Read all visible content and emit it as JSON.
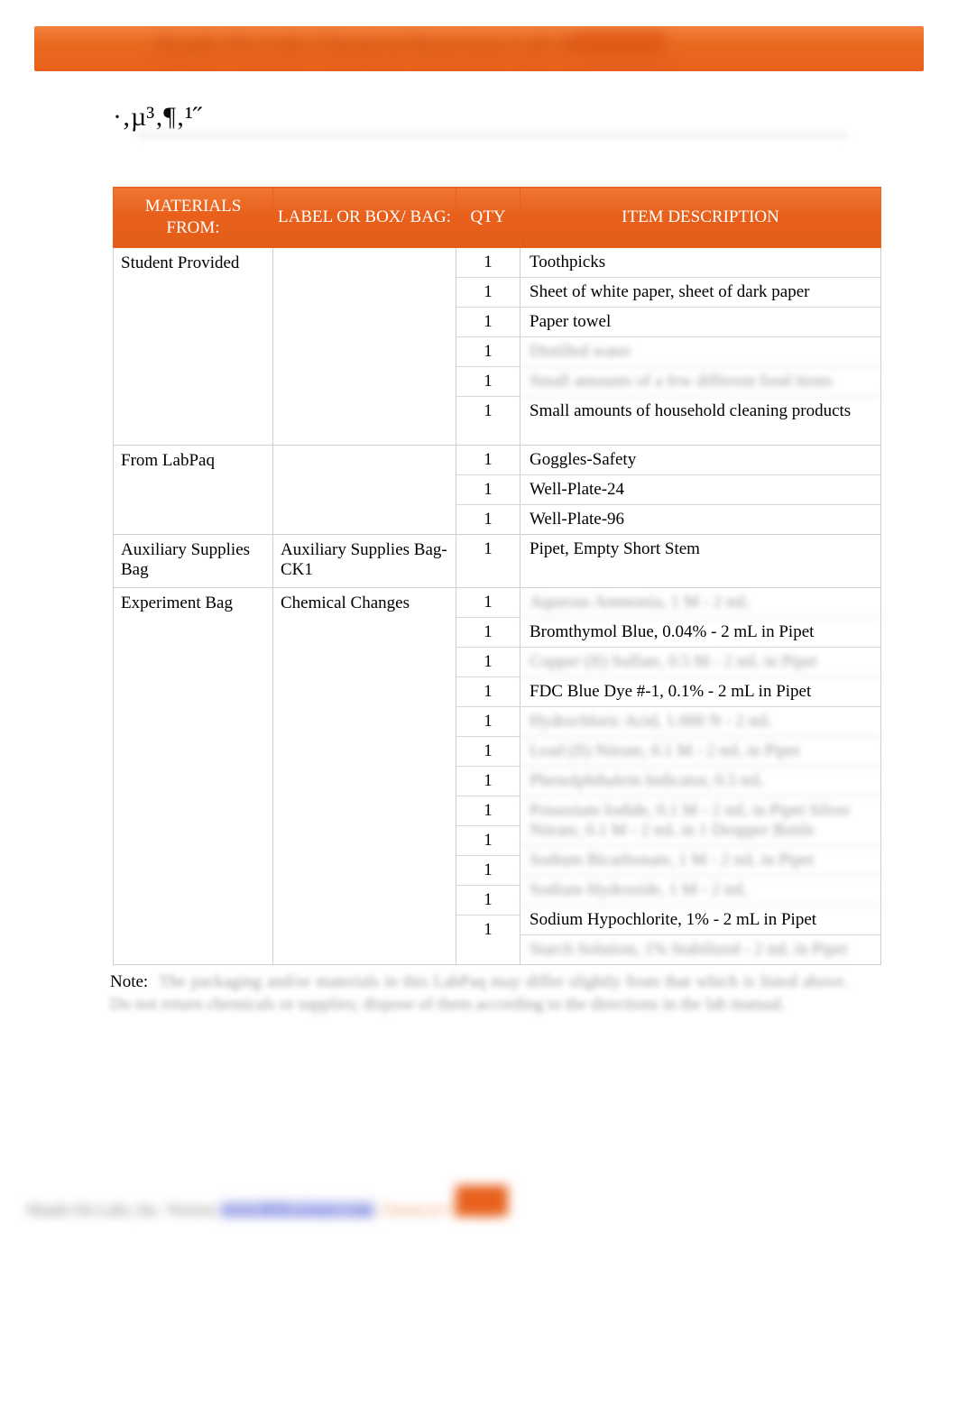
{
  "banner": {
    "title_redacted": "Hands-On Labs   Chemical Reactions Lab Manual",
    "accent_color": "#e8601c"
  },
  "heading": {
    "text": "·‚µ³‚¶‚¹˝"
  },
  "table": {
    "columns": [
      {
        "key": "from",
        "label": "MATERIALS FROM:"
      },
      {
        "key": "label",
        "label": "LABEL OR BOX/ BAG:"
      },
      {
        "key": "qty",
        "label": "QTY"
      },
      {
        "key": "desc",
        "label": "ITEM DESCRIPTION"
      }
    ],
    "header_bg": "#e8601c",
    "header_text_color": "#ffffff",
    "groups": [
      {
        "from": "Student Provided",
        "label": "",
        "items": [
          {
            "qty": "1",
            "desc": "Toothpicks",
            "redacted": false,
            "justify": false
          },
          {
            "qty": "1",
            "desc": "Sheet of white paper, sheet of dark paper",
            "redacted": false,
            "justify": false
          },
          {
            "qty": "1",
            "desc": "Paper towel",
            "redacted": false,
            "justify": false
          },
          {
            "qty": "1",
            "desc": "Distilled water",
            "redacted": true,
            "justify": false
          },
          {
            "qty": "1",
            "desc": "Small amounts of a few different food items",
            "redacted": true,
            "justify": false
          },
          {
            "qty": "1",
            "desc": "Small amounts of household cleaning products",
            "redacted": false,
            "justify": true
          }
        ]
      },
      {
        "from": "From LabPaq",
        "label": "",
        "items": [
          {
            "qty": "1",
            "desc": "Goggles-Safety",
            "redacted": false,
            "justify": false
          },
          {
            "qty": "1",
            "desc": "Well-Plate-24",
            "redacted": false,
            "justify": false
          },
          {
            "qty": "1",
            "desc": "Well-Plate-96",
            "redacted": false,
            "justify": false
          }
        ]
      },
      {
        "from": "Auxiliary Supplies Bag",
        "label": "Auxiliary Supplies Bag-CK1",
        "items": [
          {
            "qty": "1",
            "desc": "Pipet, Empty Short Stem",
            "redacted": false,
            "justify": false
          }
        ]
      },
      {
        "from": "Experiment Bag",
        "label": "Chemical Changes",
        "items": [
          {
            "qty": "1",
            "desc": "Aqueous Ammonia, 1 M - 2 mL",
            "redacted": true,
            "justify": false
          },
          {
            "qty": "1",
            "desc": "Bromthymol Blue, 0.04% - 2 mL in Pipet",
            "redacted": false,
            "justify": false
          },
          {
            "qty": "1",
            "desc": "Copper (II) Sulfate, 0.5 M - 2 mL in Pipet",
            "redacted": true,
            "justify": false
          },
          {
            "qty": "1",
            "desc": "FDC Blue Dye #-1, 0.1% - 2 mL in Pipet",
            "redacted": false,
            "justify": false
          },
          {
            "qty": "1",
            "desc": "Hydrochloric Acid, 1.000 N - 2 mL",
            "redacted": true,
            "justify": false
          },
          {
            "qty": "1",
            "desc": "Lead (II) Nitrate, 0.1 M - 2 mL in Pipet",
            "redacted": true,
            "justify": false
          },
          {
            "qty": "1",
            "desc": "Phenolphthalein Indicator, 0.5 mL",
            "redacted": true,
            "justify": false
          },
          {
            "qty": "1",
            "desc": "Potassium Iodide, 0.1 M - 2 mL in Pipet Silver Nitrate, 0.1 M - 2 mL in 1 Dropper Bottle",
            "redacted": true,
            "justify": false
          },
          {
            "qty": "1",
            "desc": "Sodium Bicarbonate, 1 M - 2 mL in Pipet",
            "redacted": true,
            "justify": false
          },
          {
            "qty": "1",
            "desc": "Sodium Hydroxide, 1 M - 2 mL",
            "redacted": true,
            "justify": false
          },
          {
            "qty": "1",
            "desc": "Sodium Hypochlorite, 1% - 2 mL in Pipet",
            "redacted": false,
            "justify": false
          },
          {
            "qty": "1",
            "desc": "Starch Solution, 1% Stabilized - 2 mL in Pipet",
            "redacted": true,
            "justify": false
          }
        ]
      }
    ]
  },
  "note": {
    "label": "Note:",
    "body": "The packaging and/or materials in this LabPaq may differ slightly from that which is listed above. Do not return chemicals or supplies; dispose of them according to the directions in the lab manual."
  },
  "footer": {
    "left": "Hands-On Labs, Inc. Version",
    "link": "www.HOLscience.com",
    "right": "Chemical Changes"
  }
}
